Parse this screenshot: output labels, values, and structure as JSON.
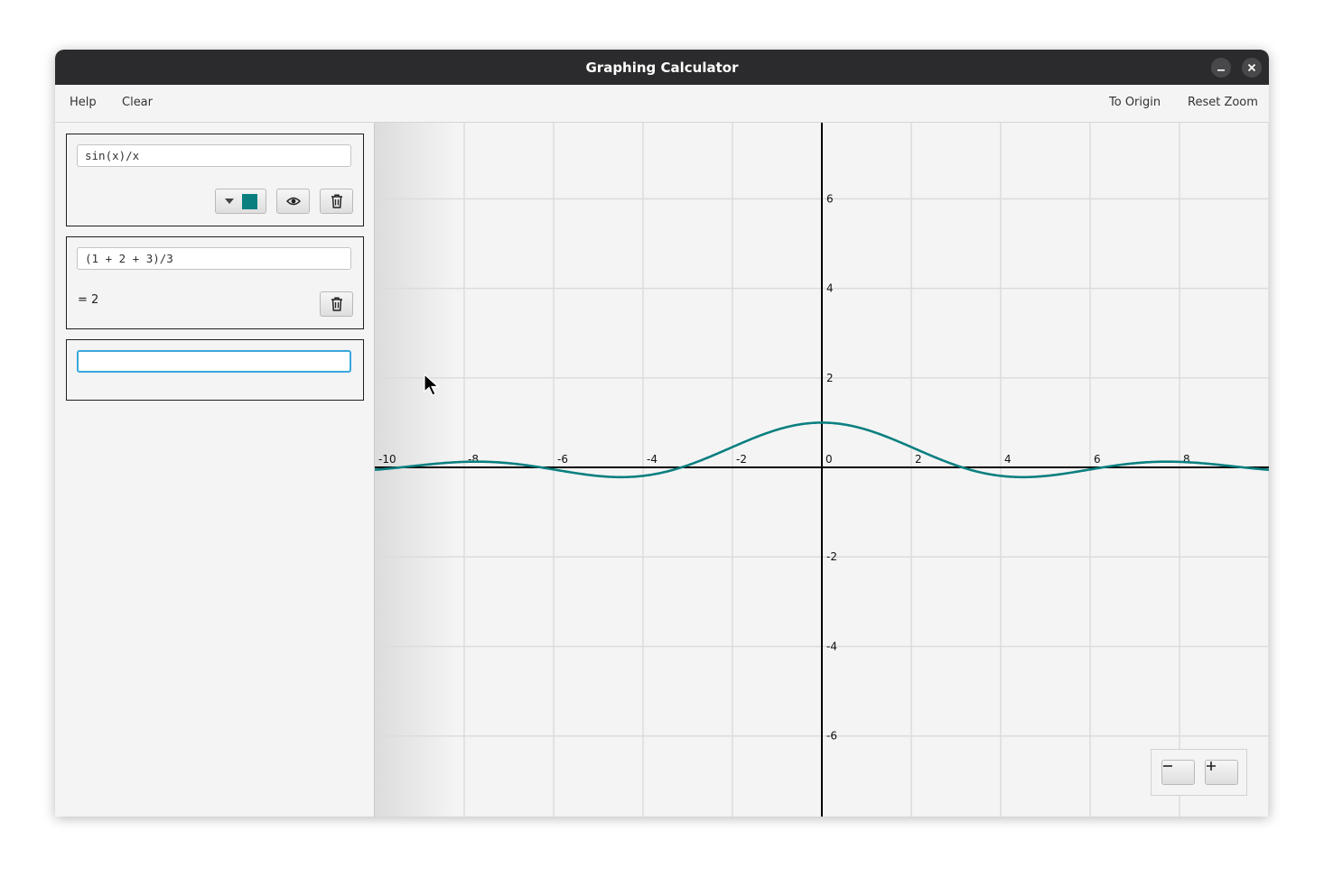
{
  "window": {
    "title": "Graphing Calculator"
  },
  "menu": {
    "help": "Help",
    "clear": "Clear",
    "to_origin": "To Origin",
    "reset_zoom": "Reset Zoom"
  },
  "expressions": [
    {
      "input": "sin(x)/x",
      "color": "#0b7f80",
      "type": "function"
    },
    {
      "input": "(1 + 2 + 3)/3",
      "result": "= 2",
      "type": "value"
    },
    {
      "input": "",
      "type": "empty"
    }
  ],
  "icons": {
    "dropdown": "chevron-down-icon",
    "color_swatch": "color-swatch-icon",
    "visibility": "eye-icon",
    "delete": "trash-icon",
    "minimize": "minimize-icon",
    "close": "close-icon",
    "zoom_out": "minus-icon",
    "zoom_in": "plus-icon"
  },
  "graph": {
    "x_range": [
      -10,
      10
    ],
    "y_range": [
      -7.8,
      7.7
    ],
    "x_ticks": [
      "-10",
      "-8",
      "-6",
      "-4",
      "-2",
      "0",
      "2",
      "4",
      "6",
      "8"
    ],
    "y_ticks": [
      "6",
      "4",
      "2",
      "-2",
      "-4",
      "-6"
    ],
    "grid": true,
    "curve_color": "#0b7f80",
    "axis_color": "#000000",
    "grid_color": "#dcdcdc"
  },
  "chart_data": {
    "type": "line",
    "series": [
      {
        "name": "sin(x)/x",
        "function": "sin(x)/x"
      }
    ],
    "xlim": [
      -10,
      10
    ],
    "ylim": [
      -7.8,
      7.7
    ],
    "x_tick_labels": [
      "-10",
      "-8",
      "-6",
      "-4",
      "-2",
      "0",
      "2",
      "4",
      "6",
      "8"
    ],
    "y_tick_labels": [
      "6",
      "4",
      "2",
      "-2",
      "-4",
      "-6"
    ],
    "grid": true
  }
}
